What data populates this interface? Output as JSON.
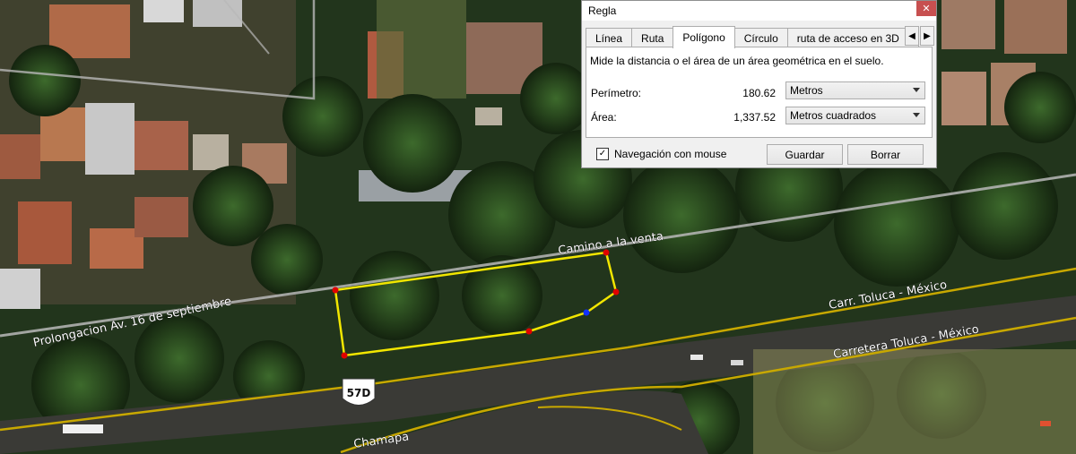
{
  "map": {
    "road_labels": {
      "camino": "Camino a la venta",
      "prolongacion": "Prolongacion Av. 16 de septiembre",
      "carr_toluca": "Carr. Toluca - México",
      "carretera_toluca": "Carretera Toluca - México",
      "chamapa": "Chamapa"
    },
    "shield_label": "57D",
    "colors": {
      "polygon": "#f2e600",
      "vertex": "#e00000",
      "midpoint": "#1030ff",
      "road_line": "#c8a800"
    }
  },
  "dialog": {
    "title": "Regla",
    "close_label": "✕",
    "tabs": [
      {
        "label": "Línea"
      },
      {
        "label": "Ruta"
      },
      {
        "label": "Polígono"
      },
      {
        "label": "Círculo"
      },
      {
        "label": "ruta de acceso en 3D"
      }
    ],
    "active_tab": "Polígono",
    "description": "Mide la distancia o el área de un área geométrica en el suelo.",
    "perimeter": {
      "label": "Perímetro:",
      "value": "180.62",
      "unit": "Metros"
    },
    "area": {
      "label": "Área:",
      "value": "1,337.52",
      "unit": "Metros cuadrados"
    },
    "mouse_nav": {
      "label": "Navegación con mouse",
      "checked": true
    },
    "save_label": "Guardar",
    "clear_label": "Borrar"
  }
}
